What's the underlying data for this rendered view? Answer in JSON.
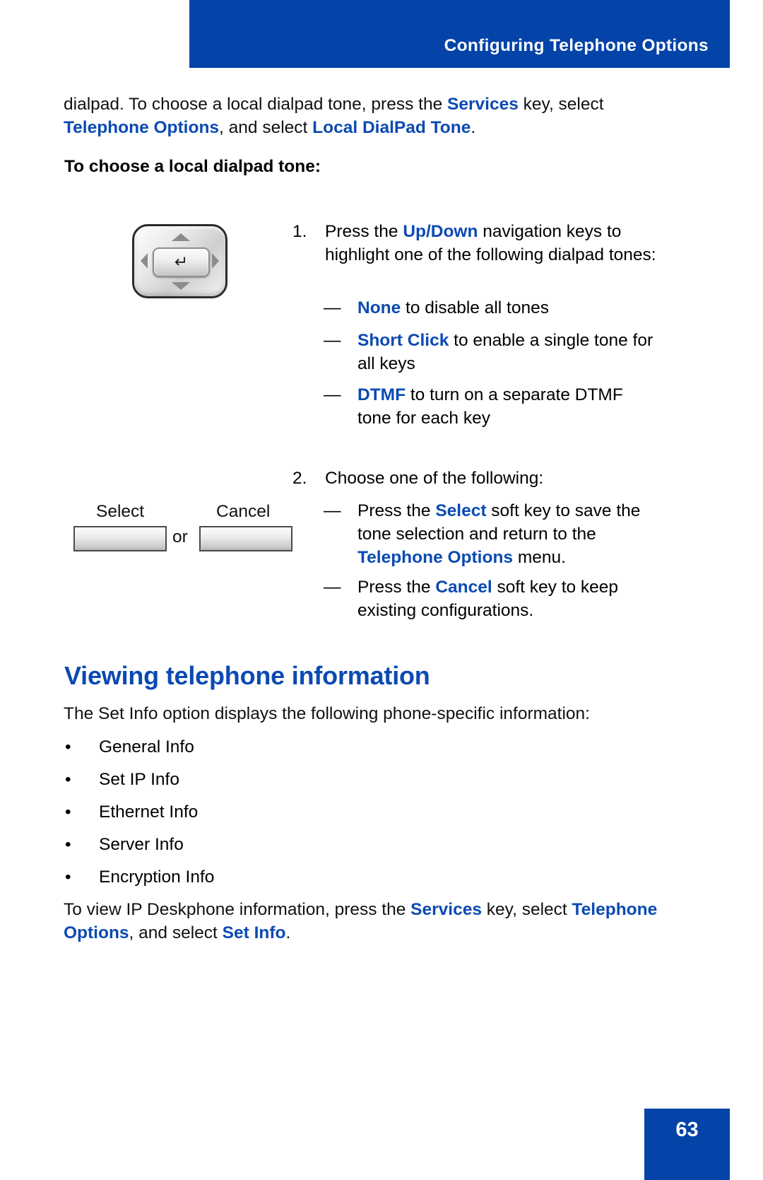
{
  "header": {
    "title": "Configuring Telephone Options",
    "background_color": "#0443a8",
    "text_color": "#ffffff"
  },
  "accent_color": "#0b4ab3",
  "intro_paragraph": {
    "part1": "dialpad. To choose a local dialpad tone, press the ",
    "link1": "Services",
    "part2": " key, select ",
    "link2": "Telephone Options",
    "part3": ", and select ",
    "link3": "Local DialPad Tone",
    "part4": "."
  },
  "subheading": "To choose a local dialpad tone:",
  "navkey": {
    "enter_glyph": "↵",
    "icon_name": "navigation-cluster"
  },
  "steps": [
    {
      "number": "1.",
      "part1": "Press the ",
      "link1": "Up/Down",
      "part2": " navigation keys to highlight one of the following dialpad tones:"
    },
    {
      "number": "2.",
      "text": "Choose one of the following:"
    }
  ],
  "tone_options": [
    {
      "dash": "—",
      "label": "None",
      "text": " to disable all tones"
    },
    {
      "dash": "—",
      "label": "Short Click",
      "text": " to enable a single tone for all keys"
    },
    {
      "dash": "—",
      "label": "DTMF",
      "text": " to turn on a separate DTMF tone for each key"
    }
  ],
  "choice_options": [
    {
      "dash": "—",
      "part1": "Press the ",
      "link1": "Select",
      "part2": " soft key to save the tone selection and return to the ",
      "link2": "Telephone Options",
      "part3": " menu."
    },
    {
      "dash": "—",
      "part1": "Press the ",
      "link1": "Cancel",
      "part2": " soft key to keep existing configurations.",
      "link2": "",
      "part3": ""
    }
  ],
  "softkeys": {
    "select_label": "Select",
    "cancel_label": "Cancel",
    "separator": "or"
  },
  "section_heading": "Viewing telephone information",
  "setinfo_paragraph": "The Set Info option displays the following phone-specific information:",
  "info_bullets": [
    {
      "mark": "•",
      "label": "General Info"
    },
    {
      "mark": "•",
      "label": "Set IP Info"
    },
    {
      "mark": "•",
      "label": "Ethernet Info"
    },
    {
      "mark": "•",
      "label": "Server Info"
    },
    {
      "mark": "•",
      "label": "Encryption Info"
    }
  ],
  "closing_paragraph": {
    "part1": "To view IP Deskphone information, press the ",
    "link1": "Services",
    "part2": " key, select ",
    "link2": "Telephone Options",
    "part3": ", and select ",
    "link3": "Set Info",
    "part4": "."
  },
  "footer": {
    "page_number": "63",
    "background_color": "#0443a8"
  }
}
